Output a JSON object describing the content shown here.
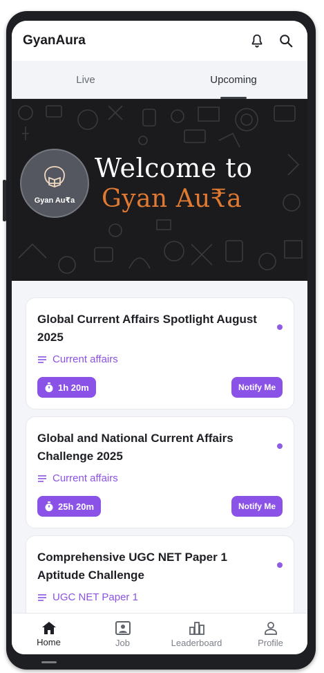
{
  "app": {
    "title": "GyanAura"
  },
  "header": {
    "notification_icon": "bell-icon",
    "search_icon": "search-icon"
  },
  "tabs": [
    {
      "label": "Live"
    },
    {
      "label": "Upcoming"
    }
  ],
  "banner": {
    "logo_text": "Gyan Au₹a",
    "welcome_line1": "Welcome to",
    "welcome_line2": "Gyan Au₹a"
  },
  "cards": [
    {
      "title": "Global Current Affairs Spotlight August 2025",
      "category": "Current affairs",
      "duration": "1h 20m",
      "action": "Notify Me"
    },
    {
      "title": "Global and National Current Affairs Challenge 2025",
      "category": "Current affairs",
      "duration": "25h 20m",
      "action": "Notify Me"
    },
    {
      "title": "Comprehensive UGC NET Paper 1 Aptitude Challenge",
      "category": "UGC NET Paper 1",
      "duration": "",
      "action": ""
    }
  ],
  "bottom_nav": [
    {
      "label": "Home",
      "icon": "home-icon"
    },
    {
      "label": "Job",
      "icon": "job-icon"
    },
    {
      "label": "Leaderboard",
      "icon": "leaderboard-icon"
    },
    {
      "label": "Profile",
      "icon": "profile-icon"
    }
  ],
  "colors": {
    "accent": "#8a52e6",
    "banner_bg": "#1b1b1d",
    "banner_orange": "#e07a32"
  }
}
